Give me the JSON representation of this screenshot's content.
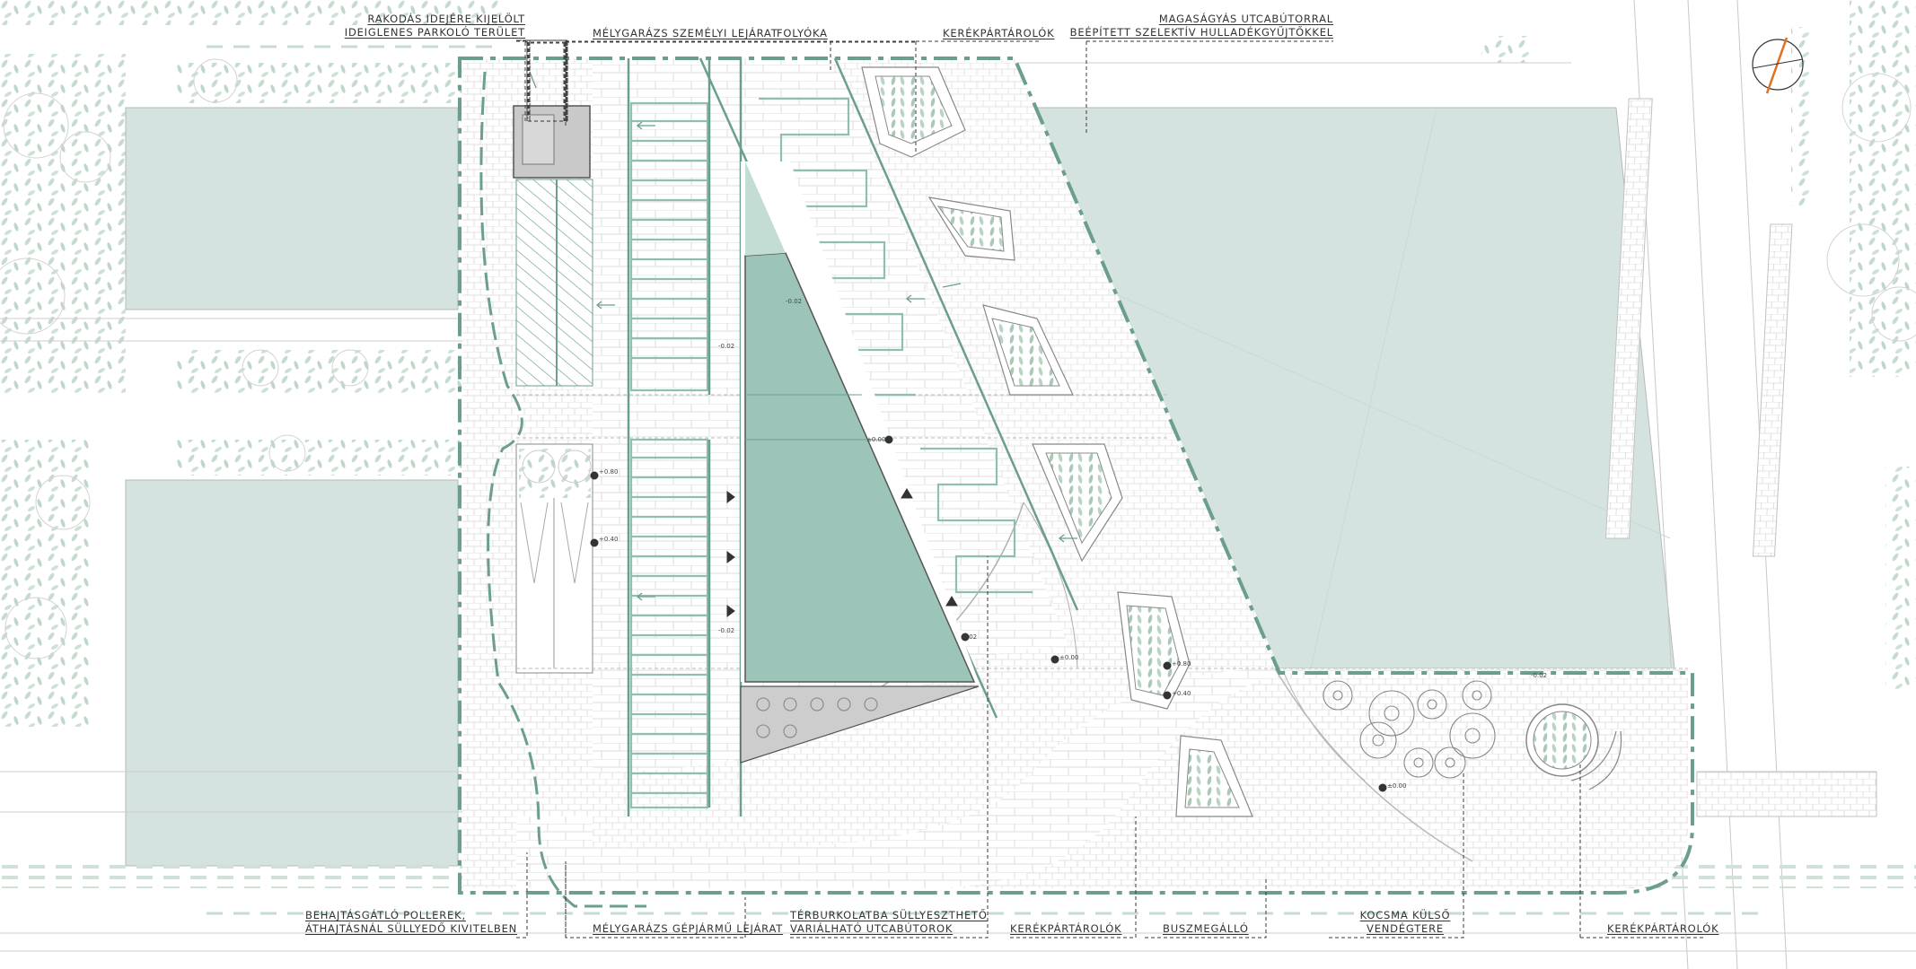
{
  "labels": {
    "top_loading_line1": "RAKODÁS IDEJÉRE KIJELÖLT",
    "top_loading_line2": "IDEIGLENES PARKOLÓ TERÜLET",
    "top_garage_pedestrian": "MÉLYGARÁZS SZEMÉLYI LEJÁRAT",
    "top_gutter": "FOLYÓKA",
    "top_bike_racks": "KERÉKPÁRTÁROLÓK",
    "top_raised_bed_line1": "MAGASÁGYÁS UTCABÚTORRAL",
    "top_raised_bed_line2": "BEÉPÍTETT SZELEKTÍV HULLADÉKGYŰJTŐKKEL",
    "bottom_bollards_line1": "BEHAJTÁSGÁTLÓ POLLEREK,",
    "bottom_bollards_line2": "ÁTHAJTÁSNÁL SÜLLYEDŐ KIVITELBEN",
    "bottom_garage_vehicle": "MÉLYGARÁZS GÉPJÁRMŰ LEJÁRAT",
    "bottom_furniture_line1": "TÉRBURKOLATBA SÜLLYESZTHETŐ",
    "bottom_furniture_line2": "VARIÁLHATÓ UTCABÚTOROK",
    "bottom_bike_racks_1": "KERÉKPÁRTÁROLÓK",
    "bottom_bus_stop": "BUSZMEGÁLLÓ",
    "bottom_pub_line1": "KOCSMA KÜLSŐ",
    "bottom_pub_line2": "VENDÉGTERE",
    "bottom_bike_racks_2": "KERÉKPÁRTÁROLÓK"
  },
  "levels": [
    "-0.02",
    "-0.02",
    "±0.00",
    "+0.80",
    "+0.40",
    "-0.02",
    "-0.02",
    "±0.00",
    "+0.80",
    "+0.40",
    "±0.00",
    "-0.02"
  ],
  "colors": {
    "site_boundary": "#6b9e8c",
    "water": "#d5e3e0",
    "pool": "#9dc4b8",
    "paving_lines": "#dcdcdc",
    "accent_green": "#7aa897",
    "hatch_green": "#8fb8a5",
    "north_arrow_accent": "#e07020"
  },
  "icons": [
    "north-arrow-icon",
    "tree-icon",
    "level-marker-icon",
    "direction-arrow-icon"
  ]
}
